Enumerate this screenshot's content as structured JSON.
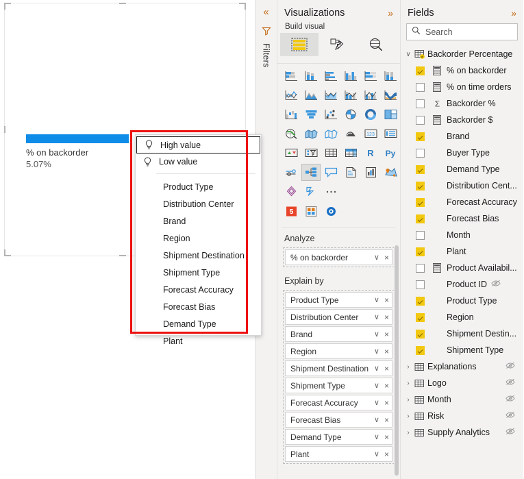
{
  "canvas": {
    "kpi": {
      "label": "% on backorder",
      "value": "5.07%",
      "bar_color": "#0e8ce8"
    }
  },
  "context_menu": {
    "highlight_color": "#ee1111",
    "items": [
      {
        "label": "High value",
        "icon": "lightbulb-icon",
        "selected": true
      },
      {
        "label": "Low value",
        "icon": "lightbulb-icon",
        "selected": false
      },
      {
        "label": "Product Type",
        "icon": "",
        "selected": false
      },
      {
        "label": "Distribution Center",
        "icon": "",
        "selected": false
      },
      {
        "label": "Brand",
        "icon": "",
        "selected": false
      },
      {
        "label": "Region",
        "icon": "",
        "selected": false
      },
      {
        "label": "Shipment Destination",
        "icon": "",
        "selected": false
      },
      {
        "label": "Shipment Type",
        "icon": "",
        "selected": false
      },
      {
        "label": "Forecast Accuracy",
        "icon": "",
        "selected": false
      },
      {
        "label": "Forecast Bias",
        "icon": "",
        "selected": false
      },
      {
        "label": "Demand Type",
        "icon": "",
        "selected": false
      },
      {
        "label": "Plant",
        "icon": "",
        "selected": false
      }
    ]
  },
  "filters_rail": {
    "collapse_chevron": "«",
    "label": "Filters",
    "icon": "filter-icon"
  },
  "visualizations": {
    "title": "Visualizations",
    "expand_chevron": "»",
    "build_label": "Build visual",
    "tabs": [
      {
        "name": "build-visual-tab",
        "icon": "fields-table-icon",
        "active": true
      },
      {
        "name": "format-visual-tab",
        "icon": "paint-roller-icon",
        "active": false
      },
      {
        "name": "analytics-tab",
        "icon": "magnifier-chart-icon",
        "active": false
      }
    ],
    "icon_rows": [
      [
        "stacked-bar-chart-icon",
        "stacked-column-chart-icon",
        "clustered-bar-chart-icon",
        "clustered-column-chart-icon",
        "hundred-stacked-bar-icon",
        "hundred-stacked-column-icon"
      ],
      [
        "line-chart-icon",
        "area-chart-icon",
        "stacked-area-chart-icon",
        "line-stacked-column-icon",
        "line-clustered-column-icon",
        "ribbon-chart-icon"
      ],
      [
        "waterfall-chart-icon",
        "funnel-chart-icon",
        "scatter-chart-icon",
        "pie-chart-icon",
        "donut-chart-icon",
        "treemap-icon"
      ],
      [
        "map-icon",
        "filled-map-icon",
        "shape-map-icon",
        "azure-map-icon",
        "card-icon",
        "multi-row-card-icon"
      ],
      [
        "kpi-icon",
        "slicer-icon",
        "table-icon",
        "matrix-icon",
        "r-script-visual-icon",
        "python-visual-icon"
      ],
      [
        "gauge-icon",
        "decomposition-tree-icon",
        "q-and-a-icon",
        "smart-narrative-icon",
        "paginated-report-icon",
        "arcgis-maps-icon"
      ],
      [
        "power-apps-icon",
        "power-automate-icon",
        "more-options-icon"
      ]
    ],
    "custom_visual_icons": [
      "html-viewer-icon",
      "custom-visual-icon",
      "power-bi-visual-icon"
    ],
    "analyze": {
      "title": "Analyze",
      "field": {
        "label": "% on backorder",
        "chevron": "∨",
        "remove": "×"
      }
    },
    "explain_by": {
      "title": "Explain by",
      "fields": [
        {
          "label": "Product Type"
        },
        {
          "label": "Distribution Center"
        },
        {
          "label": "Brand"
        },
        {
          "label": "Region"
        },
        {
          "label": "Shipment Destination"
        },
        {
          "label": "Shipment Type"
        },
        {
          "label": "Forecast Accuracy"
        },
        {
          "label": "Forecast Bias"
        },
        {
          "label": "Demand Type"
        },
        {
          "label": "Plant"
        }
      ],
      "chevron": "∨",
      "remove": "×"
    }
  },
  "fields": {
    "title": "Fields",
    "expand_chevron": "»",
    "search": {
      "placeholder": "Search",
      "icon": "search-icon"
    },
    "tables": [
      {
        "name": "Backorder Percentage",
        "expanded": true,
        "chevron": "∨",
        "hidden": false,
        "items": [
          {
            "label": "% on backorder",
            "checked": true,
            "icon": "measure-icon"
          },
          {
            "label": "% on time orders",
            "checked": false,
            "icon": "measure-icon"
          },
          {
            "label": "Backorder %",
            "checked": false,
            "icon": "sigma-icon"
          },
          {
            "label": "Backorder $",
            "checked": false,
            "icon": "measure-icon"
          },
          {
            "label": "Brand",
            "checked": true,
            "icon": ""
          },
          {
            "label": "Buyer Type",
            "checked": false,
            "icon": ""
          },
          {
            "label": "Demand Type",
            "checked": true,
            "icon": ""
          },
          {
            "label": "Distribution Cent...",
            "checked": true,
            "icon": ""
          },
          {
            "label": "Forecast Accuracy",
            "checked": true,
            "icon": ""
          },
          {
            "label": "Forecast Bias",
            "checked": true,
            "icon": ""
          },
          {
            "label": "Month",
            "checked": false,
            "icon": ""
          },
          {
            "label": "Plant",
            "checked": true,
            "icon": ""
          },
          {
            "label": "Product Availabil...",
            "checked": false,
            "icon": "measure-icon"
          },
          {
            "label": "Product ID",
            "checked": false,
            "icon": "",
            "hidden": true
          },
          {
            "label": "Product Type",
            "checked": true,
            "icon": ""
          },
          {
            "label": "Region",
            "checked": true,
            "icon": ""
          },
          {
            "label": "Shipment Destin...",
            "checked": true,
            "icon": ""
          },
          {
            "label": "Shipment Type",
            "checked": true,
            "icon": ""
          }
        ]
      },
      {
        "name": "Explanations",
        "expanded": false,
        "chevron": "›",
        "hidden": true,
        "items": []
      },
      {
        "name": "Logo",
        "expanded": false,
        "chevron": "›",
        "hidden": true,
        "items": []
      },
      {
        "name": "Month",
        "expanded": false,
        "chevron": "›",
        "hidden": true,
        "items": []
      },
      {
        "name": "Risk",
        "expanded": false,
        "chevron": "›",
        "hidden": true,
        "items": []
      },
      {
        "name": "Supply Analytics",
        "expanded": false,
        "chevron": "›",
        "hidden": true,
        "items": []
      }
    ]
  }
}
